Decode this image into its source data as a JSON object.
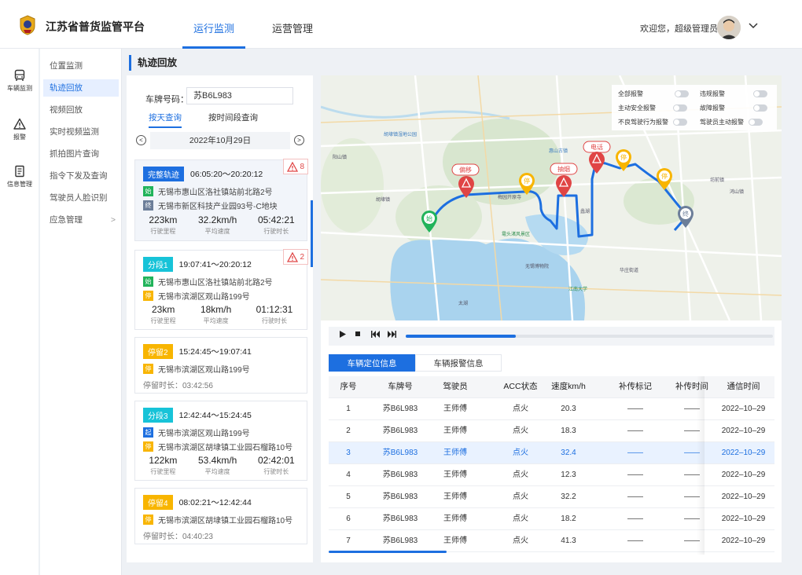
{
  "header": {
    "brand": "江苏省普货监管平台",
    "tabs": [
      "运行监测",
      "运营管理"
    ],
    "welcome": "欢迎您，超级管理员"
  },
  "sidebar": {
    "items": [
      {
        "label": "车辆监测",
        "icon": "bus-icon"
      },
      {
        "label": "报警",
        "icon": "alert-icon"
      },
      {
        "label": "信息管理",
        "icon": "document-icon"
      }
    ]
  },
  "submenu": {
    "items": [
      "位置监测",
      "轨迹回放",
      "视频回放",
      "实时视频监测",
      "抓拍图片查询",
      "指令下发及查询",
      "驾驶员人脸识别",
      "应急管理"
    ],
    "arrow": ">"
  },
  "page": {
    "title": "轨迹回放"
  },
  "query": {
    "plate_label": "车牌号码：",
    "plate_value": "苏B6L983",
    "tabs": [
      "按天查询",
      "按时间段查询"
    ],
    "date": "2022年10月29日",
    "prev": "<",
    "next": ">"
  },
  "cards": [
    {
      "badge": "完整轨迹",
      "time": "06:05:20～20:20:12",
      "warn": "8",
      "addrs": [
        {
          "tag": "始",
          "text": "无锡市惠山区洛社镇站前北路2号"
        },
        {
          "tag": "终",
          "text": "无锡市新区科技产业园93号-C地块"
        }
      ],
      "stats": [
        {
          "v": "223km",
          "l": "行驶里程"
        },
        {
          "v": "32.2km/h",
          "l": "平均速度"
        },
        {
          "v": "05:42:21",
          "l": "行驶时长"
        }
      ]
    },
    {
      "badge": "分段1",
      "time": "19:07:41～20:20:12",
      "warn": "2",
      "addrs": [
        {
          "tag": "始",
          "text": "无锡市惠山区洛社镇站前北路2号"
        },
        {
          "tag": "停",
          "text": "无锡市滨湖区观山路199号"
        }
      ],
      "stats": [
        {
          "v": "23km",
          "l": "行驶里程"
        },
        {
          "v": "18km/h",
          "l": "平均速度"
        },
        {
          "v": "01:12:31",
          "l": "行驶时长"
        }
      ]
    },
    {
      "badge": "停留2",
      "time": "15:24:45～19:07:41",
      "addrs": [
        {
          "tag": "停",
          "text": "无锡市滨湖区观山路199号"
        }
      ],
      "stay": "停留时长：03:42:56"
    },
    {
      "badge": "分段3",
      "time": "12:42:44～15:24:45",
      "addrs": [
        {
          "tag": "起",
          "text": "无锡市滨湖区观山路199号"
        },
        {
          "tag": "停",
          "text": "无锡市滨湖区胡埭镇工业园石榴路10号"
        }
      ],
      "stats": [
        {
          "v": "122km",
          "l": "行驶里程"
        },
        {
          "v": "53.4km/h",
          "l": "平均速度"
        },
        {
          "v": "02:42:01",
          "l": "行驶时长"
        }
      ]
    },
    {
      "badge": "停留4",
      "time": "08:02:21～12:42:44",
      "addrs": [
        {
          "tag": "停",
          "text": "无锡市滨湖区胡埭镇工业园石榴路10号"
        }
      ],
      "stay": "停留时长：04:40:23"
    }
  ],
  "map": {
    "alarms": [
      "全部报警",
      "违规报警",
      "主动安全报警",
      "故障报警",
      "不良驾驶行为报警",
      "驾驶员主动报警"
    ],
    "markers": {
      "start": "始",
      "end": "终",
      "stops": [
        "停",
        "停",
        "停",
        "停"
      ],
      "events": [
        "偏移",
        "抽烟",
        "电话"
      ]
    },
    "places": [
      "阳山镇",
      "胡埭镇",
      "胡埭镇湿地公园",
      "惠山古镇",
      "蠡湖",
      "太湖",
      "梅园开原寺",
      "鼋头渚风景区",
      "江南大学",
      "无锡博物院",
      "鸿山镇",
      "坊前镇",
      "华庄街道"
    ]
  },
  "player": {
    "progress": 0.3
  },
  "info_tabs": [
    "车辆定位信息",
    "车辆报警信息"
  ],
  "table": {
    "columns": [
      "序号",
      "车牌号",
      "驾驶员",
      "ACC状态",
      "速度km/h",
      "补传标记",
      "补传时间",
      "通信时间"
    ],
    "rows": [
      [
        "1",
        "苏B6L983",
        "王师傅",
        "点火",
        "20.3",
        "——",
        "——",
        "2022–10–29"
      ],
      [
        "2",
        "苏B6L983",
        "王师傅",
        "点火",
        "18.3",
        "——",
        "——",
        "2022–10–29"
      ],
      [
        "3",
        "苏B6L983",
        "王师傅",
        "点火",
        "32.4",
        "——",
        "——",
        "2022–10–29"
      ],
      [
        "4",
        "苏B6L983",
        "王师傅",
        "点火",
        "12.3",
        "——",
        "——",
        "2022–10–29"
      ],
      [
        "5",
        "苏B6L983",
        "王师傅",
        "点火",
        "32.2",
        "——",
        "——",
        "2022–10–29"
      ],
      [
        "6",
        "苏B6L983",
        "王师傅",
        "点火",
        "18.2",
        "——",
        "——",
        "2022–10–29"
      ],
      [
        "7",
        "苏B6L983",
        "王师傅",
        "点火",
        "41.3",
        "——",
        "——",
        "2022–10–29"
      ]
    ],
    "selected_index": 2
  },
  "colors": {
    "accent": "#1d6fe0",
    "route": "#1d6fe0",
    "alarm": "#e04545",
    "stop": "#f8b500",
    "start": "#21b35a"
  }
}
